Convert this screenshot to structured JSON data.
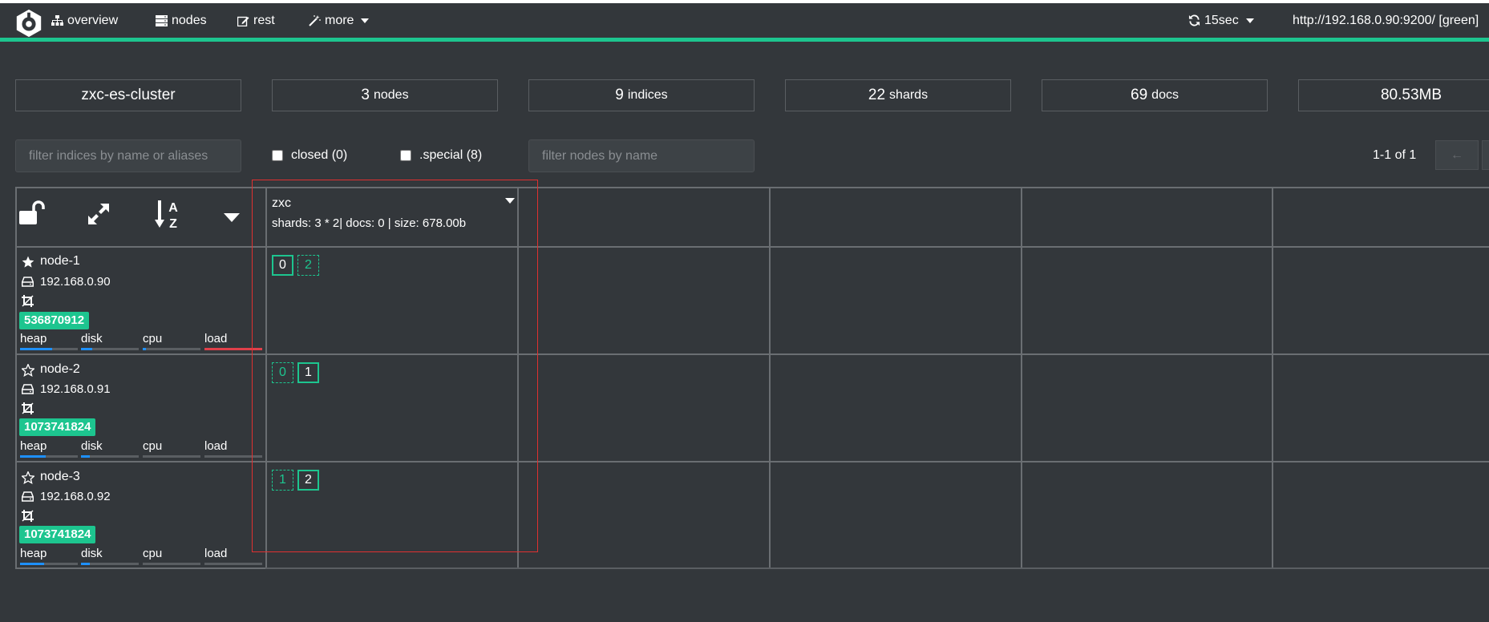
{
  "nav": {
    "overview": "overview",
    "nodes": "nodes",
    "rest": "rest",
    "more": "more",
    "refresh": "15sec",
    "cluster_url": "http://192.168.0.90:9200/ [green]"
  },
  "stats": {
    "cluster_name": "zxc-es-cluster",
    "nodes_num": "3",
    "nodes_unit": "nodes",
    "indices_num": "9",
    "indices_unit": "indices",
    "shards_num": "22",
    "shards_unit": "shards",
    "docs_num": "69",
    "docs_unit": "docs",
    "size": "80.53MB"
  },
  "filters": {
    "indices_placeholder": "filter indices by name or aliases",
    "closed_label": "closed (0)",
    "special_label": ".special (8)",
    "nodes_placeholder": "filter nodes by name",
    "pagination": "1-1 of 1",
    "prev": "←"
  },
  "index": {
    "name": "zxc",
    "stats": "shards: 3 * 2| docs: 0 | size: 678.00b"
  },
  "nodes": [
    {
      "name": "node-1",
      "ip": "192.168.0.90",
      "badge": "536870912",
      "master": true,
      "shards": [
        {
          "id": "0",
          "primary": true
        },
        {
          "id": "2",
          "primary": false
        }
      ],
      "metrics": {
        "heap": 0.55,
        "disk": 0.2,
        "cpu": 0.05,
        "load": 1.0
      }
    },
    {
      "name": "node-2",
      "ip": "192.168.0.91",
      "badge": "1073741824",
      "master": false,
      "shards": [
        {
          "id": "0",
          "primary": false
        },
        {
          "id": "1",
          "primary": true
        }
      ],
      "metrics": {
        "heap": 0.45,
        "disk": 0.15,
        "cpu": 0.0,
        "load": 0.0
      }
    },
    {
      "name": "node-3",
      "ip": "192.168.0.92",
      "badge": "1073741824",
      "master": false,
      "shards": [
        {
          "id": "1",
          "primary": false
        },
        {
          "id": "2",
          "primary": true
        }
      ],
      "metrics": {
        "heap": 0.42,
        "disk": 0.15,
        "cpu": 0.0,
        "load": 0.0
      }
    }
  ],
  "metric_labels": {
    "heap": "heap",
    "disk": "disk",
    "cpu": "cpu",
    "load": "load"
  },
  "colors": {
    "accent": "#1dc58f",
    "background": "#33373b",
    "highlight": "#e03030",
    "bar_blue": "#1e90ff",
    "bar_red": "#e0404a"
  },
  "icons": {
    "logo": "cerebro-logo-icon",
    "overview": "sitemap-icon",
    "nodes": "server-icon",
    "rest": "edit-icon",
    "more": "magic-wand-icon",
    "refresh": "refresh-icon",
    "lock": "unlock-icon",
    "expand": "expand-icon",
    "sort": "sort-alpha-icon",
    "node_master": "star-icon",
    "node": "star-outline-icon",
    "ip": "hdd-icon",
    "crop": "crop-icon"
  }
}
